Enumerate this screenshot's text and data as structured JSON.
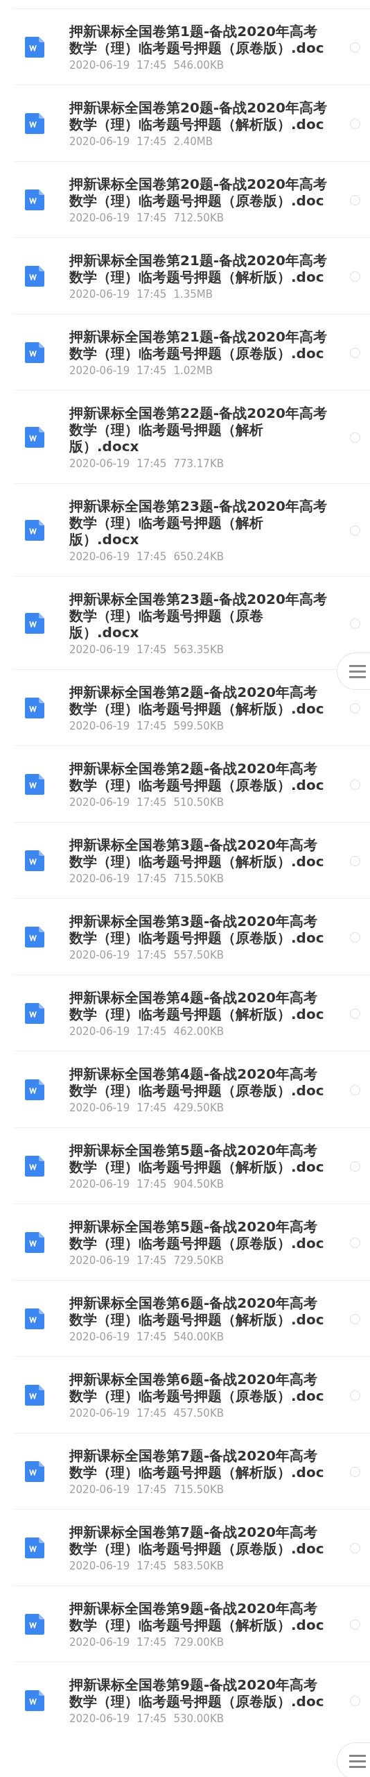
{
  "files": [
    {
      "name": "押新课标全国卷第1题-备战2020年高考数学（理）临考题号押题（原卷版）.doc",
      "date": "2020-06-19",
      "time": "17:45",
      "size": "546.00KB",
      "selected": false
    },
    {
      "name": "押新课标全国卷第20题-备战2020年高考数学（理）临考题号押题（解析版）.doc",
      "date": "2020-06-19",
      "time": "17:45",
      "size": "2.40MB",
      "selected": false
    },
    {
      "name": "押新课标全国卷第20题-备战2020年高考数学（理）临考题号押题（原卷版）.doc",
      "date": "2020-06-19",
      "time": "17:45",
      "size": "712.50KB",
      "selected": false
    },
    {
      "name": "押新课标全国卷第21题-备战2020年高考数学（理）临考题号押题（解析版）.doc",
      "date": "2020-06-19",
      "time": "17:45",
      "size": "1.35MB",
      "selected": false
    },
    {
      "name": "押新课标全国卷第21题-备战2020年高考数学（理）临考题号押题（原卷版）.doc",
      "date": "2020-06-19",
      "time": "17:45",
      "size": "1.02MB",
      "selected": false
    },
    {
      "name": "押新课标全国卷第22题-备战2020年高考数学（理）临考题号押题（解析版）.docx",
      "date": "2020-06-19",
      "time": "17:45",
      "size": "773.17KB",
      "selected": false
    },
    {
      "name": "押新课标全国卷第23题-备战2020年高考数学（理）临考题号押题（解析版）.docx",
      "date": "2020-06-19",
      "time": "17:45",
      "size": "650.24KB",
      "selected": false
    },
    {
      "name": "押新课标全国卷第23题-备战2020年高考数学（理）临考题号押题（原卷版）.docx",
      "date": "2020-06-19",
      "time": "17:45",
      "size": "563.35KB",
      "selected": false
    },
    {
      "name": "押新课标全国卷第2题-备战2020年高考数学（理）临考题号押题（解析版）.doc",
      "date": "2020-06-19",
      "time": "17:45",
      "size": "599.50KB",
      "selected": false
    },
    {
      "name": "押新课标全国卷第2题-备战2020年高考数学（理）临考题号押题（原卷版）.doc",
      "date": "2020-06-19",
      "time": "17:45",
      "size": "510.50KB",
      "selected": false
    },
    {
      "name": "押新课标全国卷第3题-备战2020年高考数学（理）临考题号押题（解析版）.doc",
      "date": "2020-06-19",
      "time": "17:45",
      "size": "715.50KB",
      "selected": false
    },
    {
      "name": "押新课标全国卷第3题-备战2020年高考数学（理）临考题号押题（原卷版）.doc",
      "date": "2020-06-19",
      "time": "17:45",
      "size": "557.50KB",
      "selected": false
    },
    {
      "name": "押新课标全国卷第4题-备战2020年高考数学（理）临考题号押题（解析版）.doc",
      "date": "2020-06-19",
      "time": "17:45",
      "size": "462.00KB",
      "selected": false
    },
    {
      "name": "押新课标全国卷第4题-备战2020年高考数学（理）临考题号押题（原卷版）.doc",
      "date": "2020-06-19",
      "time": "17:45",
      "size": "429.50KB",
      "selected": false
    },
    {
      "name": "押新课标全国卷第5题-备战2020年高考数学（理）临考题号押题（解析版）.doc",
      "date": "2020-06-19",
      "time": "17:45",
      "size": "904.50KB",
      "selected": false
    },
    {
      "name": "押新课标全国卷第5题-备战2020年高考数学（理）临考题号押题（原卷版）.doc",
      "date": "2020-06-19",
      "time": "17:45",
      "size": "729.50KB",
      "selected": false
    },
    {
      "name": "押新课标全国卷第6题-备战2020年高考数学（理）临考题号押题（解析版）.doc",
      "date": "2020-06-19",
      "time": "17:45",
      "size": "540.00KB",
      "selected": false
    },
    {
      "name": "押新课标全国卷第6题-备战2020年高考数学（理）临考题号押题（原卷版）.doc",
      "date": "2020-06-19",
      "time": "17:45",
      "size": "457.50KB",
      "selected": false
    },
    {
      "name": "押新课标全国卷第7题-备战2020年高考数学（理）临考题号押题（解析版）.doc",
      "date": "2020-06-19",
      "time": "17:45",
      "size": "715.50KB",
      "selected": false
    },
    {
      "name": "押新课标全国卷第7题-备战2020年高考数学（理）临考题号押题（原卷版）.doc",
      "date": "2020-06-19",
      "time": "17:45",
      "size": "583.50KB",
      "selected": false
    },
    {
      "name": "押新课标全国卷第9题-备战2020年高考数学（理）临考题号押题（解析版）.doc",
      "date": "2020-06-19",
      "time": "17:45",
      "size": "729.00KB",
      "selected": false
    },
    {
      "name": "押新课标全国卷第9题-备战2020年高考数学（理）临考题号押题（原卷版）.doc",
      "date": "2020-06-19",
      "time": "17:45",
      "size": "530.00KB",
      "selected": false
    }
  ]
}
